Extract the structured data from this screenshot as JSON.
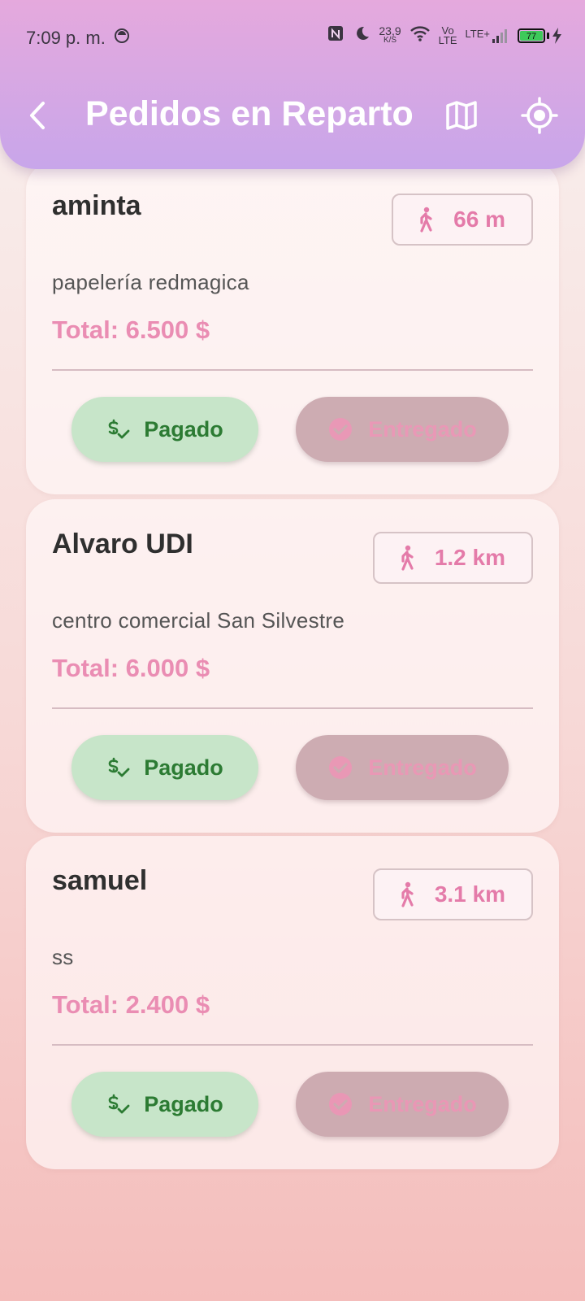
{
  "status_bar": {
    "time": "7:09 p. m.",
    "net_speed_value": "23,9",
    "net_speed_unit": "K/S",
    "volte_top": "Vo",
    "volte_bottom": "LTE",
    "network_label": "LTE+",
    "battery_level": "77"
  },
  "app_bar": {
    "title": "Pedidos en Reparto"
  },
  "orders": [
    {
      "customer": "aminta",
      "distance": "66 m",
      "address": "papelería redmagica",
      "total": "Total: 6.500 $",
      "paid_label": "Pagado",
      "delivered_label": "Entregado"
    },
    {
      "customer": "Alvaro UDI",
      "distance": "1.2 km",
      "address": "centro comercial San Silvestre",
      "total": "Total: 6.000 $",
      "paid_label": "Pagado",
      "delivered_label": "Entregado"
    },
    {
      "customer": "samuel",
      "distance": "3.1 km",
      "address": "ss",
      "total": "Total: 2.400 $",
      "paid_label": "Pagado",
      "delivered_label": "Entregado"
    }
  ],
  "colors": {
    "app_bar_top": "#e5a9dd",
    "app_bar_bottom": "#c8a6ea",
    "accent_pink": "#ea8db3",
    "paid_bg": "#c7e5c9",
    "paid_text": "#2c7b33",
    "delivered_bg": "#c8a5ac"
  }
}
